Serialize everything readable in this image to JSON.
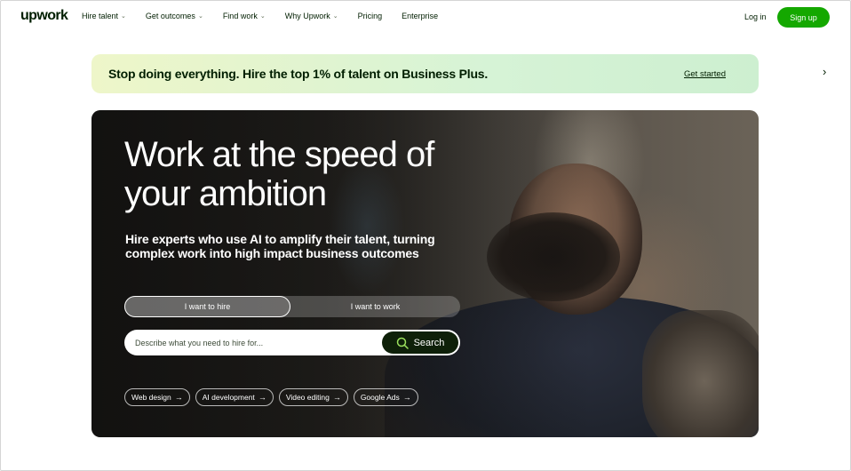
{
  "header": {
    "logo": "upwork",
    "nav": [
      {
        "label": "Hire talent",
        "chevron": true
      },
      {
        "label": "Get outcomes",
        "chevron": true
      },
      {
        "label": "Find work",
        "chevron": true
      },
      {
        "label": "Why Upwork",
        "chevron": true
      },
      {
        "label": "Pricing",
        "chevron": false
      },
      {
        "label": "Enterprise",
        "chevron": false
      }
    ],
    "login": "Log in",
    "signup": "Sign up"
  },
  "banner": {
    "text": "Stop doing everything. Hire the top 1% of talent on Business Plus.",
    "link": "Get started"
  },
  "hero": {
    "title": "Work at the speed of your ambition",
    "subtitle": "Hire experts who use AI to amplify their talent, turning complex work into high impact business outcomes",
    "toggle": {
      "hire": "I want to hire",
      "work": "I want to work",
      "selected": "hire"
    },
    "search": {
      "placeholder": "Describe what you need to hire for...",
      "button": "Search"
    },
    "chips": [
      "Web design",
      "AI development",
      "Video editing",
      "Google Ads"
    ]
  },
  "colors": {
    "brand_green": "#14a800",
    "text": "#001e00"
  }
}
